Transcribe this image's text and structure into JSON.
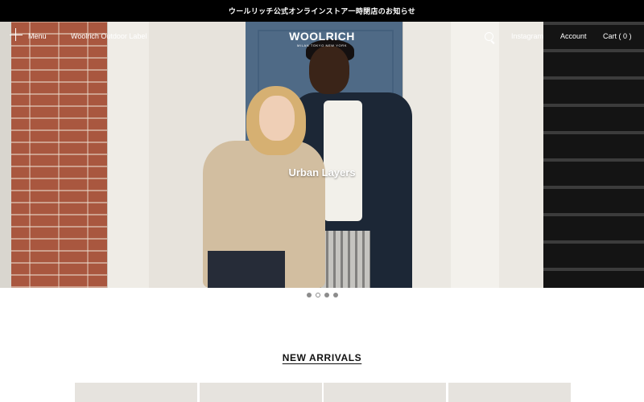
{
  "announcement": "ウールリッチ公式オンラインストア一時閉店のお知らせ",
  "header": {
    "menu_label": "Menu",
    "outdoor_label": "Woolrich Outdoor Label",
    "logo_text": "WOOLRICH",
    "logo_subtext": "MILAN TOKYO NEW YORK",
    "instagram_label": "Instagram",
    "account_label": "Account",
    "cart_label": "Cart ( 0 )"
  },
  "hero": {
    "caption": "Urban Layers",
    "slides": 4,
    "active_slide": 2
  },
  "new_arrivals": {
    "title": "NEW ARRIVALS",
    "visible_tiles": 4
  },
  "colors": {
    "announcement_bg": "#000000",
    "text_on_dark": "#ffffff",
    "page_bg": "#ffffff"
  }
}
